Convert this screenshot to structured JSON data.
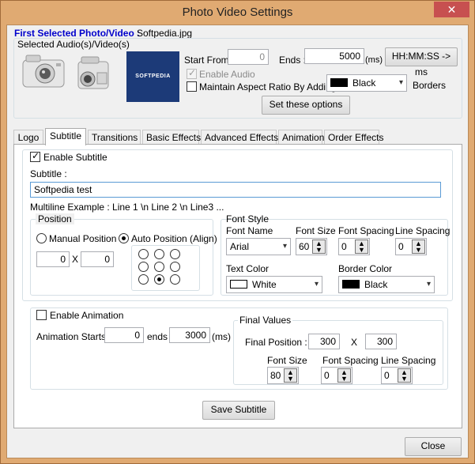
{
  "window": {
    "title": "Photo Video Settings",
    "close_glyph": "✕"
  },
  "header": {
    "first_selected_label": "First Selected Photo/Video :",
    "first_selected_value": "Softpedia.jpg",
    "selected_audio_label": "Selected Audio(s)/Video(s)",
    "thumbnail_text": "SOFTPEDIA",
    "start_from_label": "Start From :",
    "start_from_value": "0",
    "ends_label": "Ends :",
    "ends_value": "5000",
    "ms_label": "(ms)",
    "hhmmss_button": "HH:MM:SS -> ms",
    "enable_audio_label": "Enable Audio",
    "enable_audio_checked": true,
    "maintain_aspect_label": "Maintain Aspect Ratio By Adding",
    "maintain_aspect_checked": false,
    "border_color_value": "Black",
    "borders_label": "Borders",
    "set_options_button": "Set these options"
  },
  "tabs": [
    {
      "label": "Logo",
      "active": false
    },
    {
      "label": "Subtitle",
      "active": true
    },
    {
      "label": "Transitions",
      "active": false
    },
    {
      "label": "Basic Effects",
      "active": false
    },
    {
      "label": "Advanced Effects",
      "active": false
    },
    {
      "label": "Animation",
      "active": false
    },
    {
      "label": "Order Effects",
      "active": false
    }
  ],
  "subtitle": {
    "enable_label": "Enable Subtitle",
    "enable_checked": true,
    "subtitle_label": "Subtitle :",
    "subtitle_value": "Softpedia test",
    "multiline_example": "Multiline Example : Line 1 \\n Line 2 \\n Line3 ...",
    "position_group": "Position",
    "manual_position_label": "Manual Position",
    "auto_position_label": "Auto Position (Align)",
    "auto_selected": true,
    "pos_x": "0",
    "pos_y": "0",
    "x_sep": "X",
    "align_selected_index": 7,
    "font_style_group": "Font Style",
    "font_name_label": "Font Name",
    "font_name_value": "Arial",
    "font_size_label": "Font Size",
    "font_size_value": "60",
    "font_spacing_label": "Font Spacing",
    "font_spacing_value": "0",
    "line_spacing_label": "Line Spacing",
    "line_spacing_value": "0",
    "text_color_label": "Text Color",
    "text_color_value": "White",
    "border_color_label": "Border Color",
    "border_color_value": "Black",
    "enable_animation_label": "Enable Animation",
    "enable_animation_checked": false,
    "anim_starts_label": "Animation Starts :",
    "anim_starts_value": "0",
    "anim_ends_label": "ends :",
    "anim_ends_value": "3000",
    "anim_ms_label": "(ms)",
    "final_values_group": "Final Values",
    "final_position_label": "Final Position :",
    "final_x": "300",
    "final_y": "300",
    "final_font_size_label": "Font Size",
    "final_font_size_value": "80",
    "final_font_spacing_label": "Font Spacing",
    "final_font_spacing_value": "0",
    "final_line_spacing_label": "Line Spacing",
    "final_line_spacing_value": "0",
    "save_button": "Save Subtitle"
  },
  "footer": {
    "close_button": "Close"
  },
  "colors": {
    "title_blue": "#0000cc",
    "frame": "#e0aa72",
    "thumb_bg": "#1c3a78"
  }
}
